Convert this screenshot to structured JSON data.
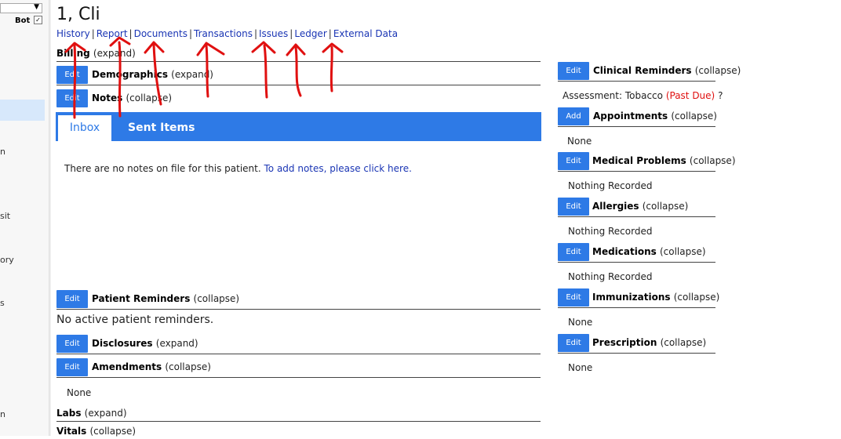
{
  "left_frame": {
    "bot_label": "Bot",
    "bot_checked": "✓",
    "cut_labels": [
      "n",
      "sit",
      "ory",
      "s",
      "n"
    ]
  },
  "patient": {
    "name": "1, Cli"
  },
  "nav": {
    "links": [
      "History",
      "Report",
      "Documents",
      "Transactions",
      "Issues",
      "Ledger",
      "External Data"
    ]
  },
  "left_sections": {
    "billing": {
      "title": "Billing",
      "state": "(expand)"
    },
    "demographics": {
      "button": "Edit",
      "title": "Demographics",
      "state": "(expand)"
    },
    "notes": {
      "button": "Edit",
      "title": "Notes",
      "state": "(collapse)"
    },
    "tabs": {
      "inbox": "Inbox",
      "sent": "Sent Items"
    },
    "notes_message": "There are no notes on file for this patient.",
    "notes_link": "To add notes, please click here.",
    "patient_reminders": {
      "button": "Edit",
      "title": "Patient Reminders",
      "state": "(collapse)",
      "body": "No active patient reminders."
    },
    "disclosures": {
      "button": "Edit",
      "title": "Disclosures",
      "state": "(expand)"
    },
    "amendments": {
      "button": "Edit",
      "title": "Amendments",
      "state": "(collapse)",
      "body": "None"
    },
    "labs": {
      "title": "Labs",
      "state": "(expand)"
    },
    "vitals": {
      "title": "Vitals",
      "state": "(collapse)"
    }
  },
  "right_sections": {
    "clinical_reminders": {
      "button": "Edit",
      "title": "Clinical Reminders",
      "state": "(collapse)",
      "assessment": "Assessment: Tobacco",
      "due": "(Past Due)",
      "help": "?"
    },
    "appointments": {
      "button": "Add",
      "title": "Appointments",
      "state": "(collapse)",
      "body": "None"
    },
    "medical_problems": {
      "button": "Edit",
      "title": "Medical Problems",
      "state": "(collapse)",
      "body": "Nothing Recorded"
    },
    "allergies": {
      "button": "Edit",
      "title": "Allergies",
      "state": "(collapse)",
      "body": "Nothing Recorded"
    },
    "medications": {
      "button": "Edit",
      "title": "Medications",
      "state": "(collapse)",
      "body": "Nothing Recorded"
    },
    "immunizations": {
      "button": "Edit",
      "title": "Immunizations",
      "state": "(collapse)",
      "body": "None"
    },
    "prescription": {
      "button": "Edit",
      "title": "Prescription",
      "state": "(collapse)",
      "body": "None"
    }
  },
  "colors": {
    "accent": "#2e7ae6",
    "link": "#1a35b4",
    "annotation": "#e01010",
    "past_due": "#e01010"
  }
}
